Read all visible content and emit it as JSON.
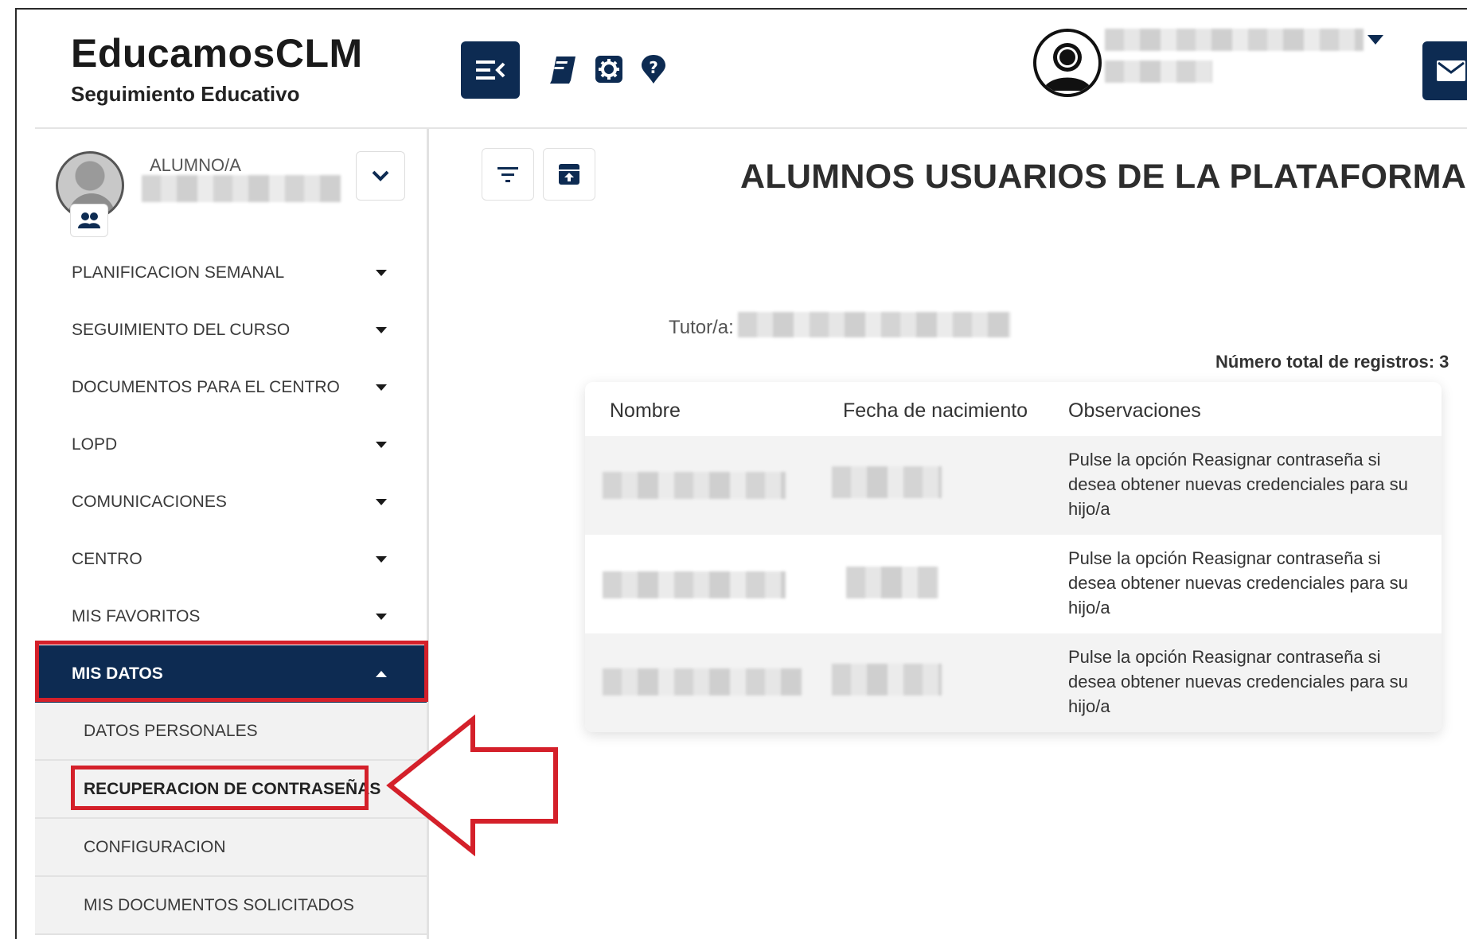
{
  "header": {
    "brand_title": "EducamosCLM",
    "brand_subtitle": "Seguimiento Educativo",
    "icons": [
      "menu-collapse-icon",
      "book-icon",
      "gear-icon",
      "help-icon",
      "user-avatar-icon",
      "mail-icon"
    ]
  },
  "student": {
    "role": "ALUMNO/A"
  },
  "sidebar": {
    "items": [
      {
        "label": "PLANIFICACION SEMANAL"
      },
      {
        "label": "SEGUIMIENTO DEL CURSO"
      },
      {
        "label": "DOCUMENTOS PARA EL CENTRO"
      },
      {
        "label": "LOPD"
      },
      {
        "label": "COMUNICACIONES"
      },
      {
        "label": "CENTRO"
      },
      {
        "label": "MIS FAVORITOS"
      },
      {
        "label": "MIS DATOS",
        "active": true
      }
    ],
    "subitems": [
      {
        "label": "DATOS PERSONALES"
      },
      {
        "label": "RECUPERACION DE CONTRASEÑAS",
        "current": true
      },
      {
        "label": "CONFIGURACION"
      },
      {
        "label": "MIS DOCUMENTOS SOLICITADOS"
      }
    ]
  },
  "main": {
    "title": "ALUMNOS USUARIOS DE LA PLATAFORMA",
    "tutor_label": "Tutor/a:",
    "total_label": "Número total de registros: 3",
    "table": {
      "columns": [
        "Nombre",
        "Fecha de nacimiento",
        "Observaciones"
      ],
      "rows": [
        {
          "observaciones": [
            "Pulse la opción Reasignar contraseña si",
            "desea obtener nuevas credenciales para su",
            "hijo/a"
          ]
        },
        {
          "observaciones": [
            "Pulse la opción Reasignar contraseña si",
            "desea obtener nuevas credenciales para su",
            "hijo/a"
          ]
        },
        {
          "observaciones": [
            "Pulse la opción Reasignar contraseña si",
            "desea obtener nuevas credenciales para su",
            "hijo/a"
          ]
        }
      ]
    }
  },
  "colors": {
    "primary": "#0d2b52",
    "highlight": "#d4202a",
    "submenu_bg": "#f2f2f2"
  }
}
